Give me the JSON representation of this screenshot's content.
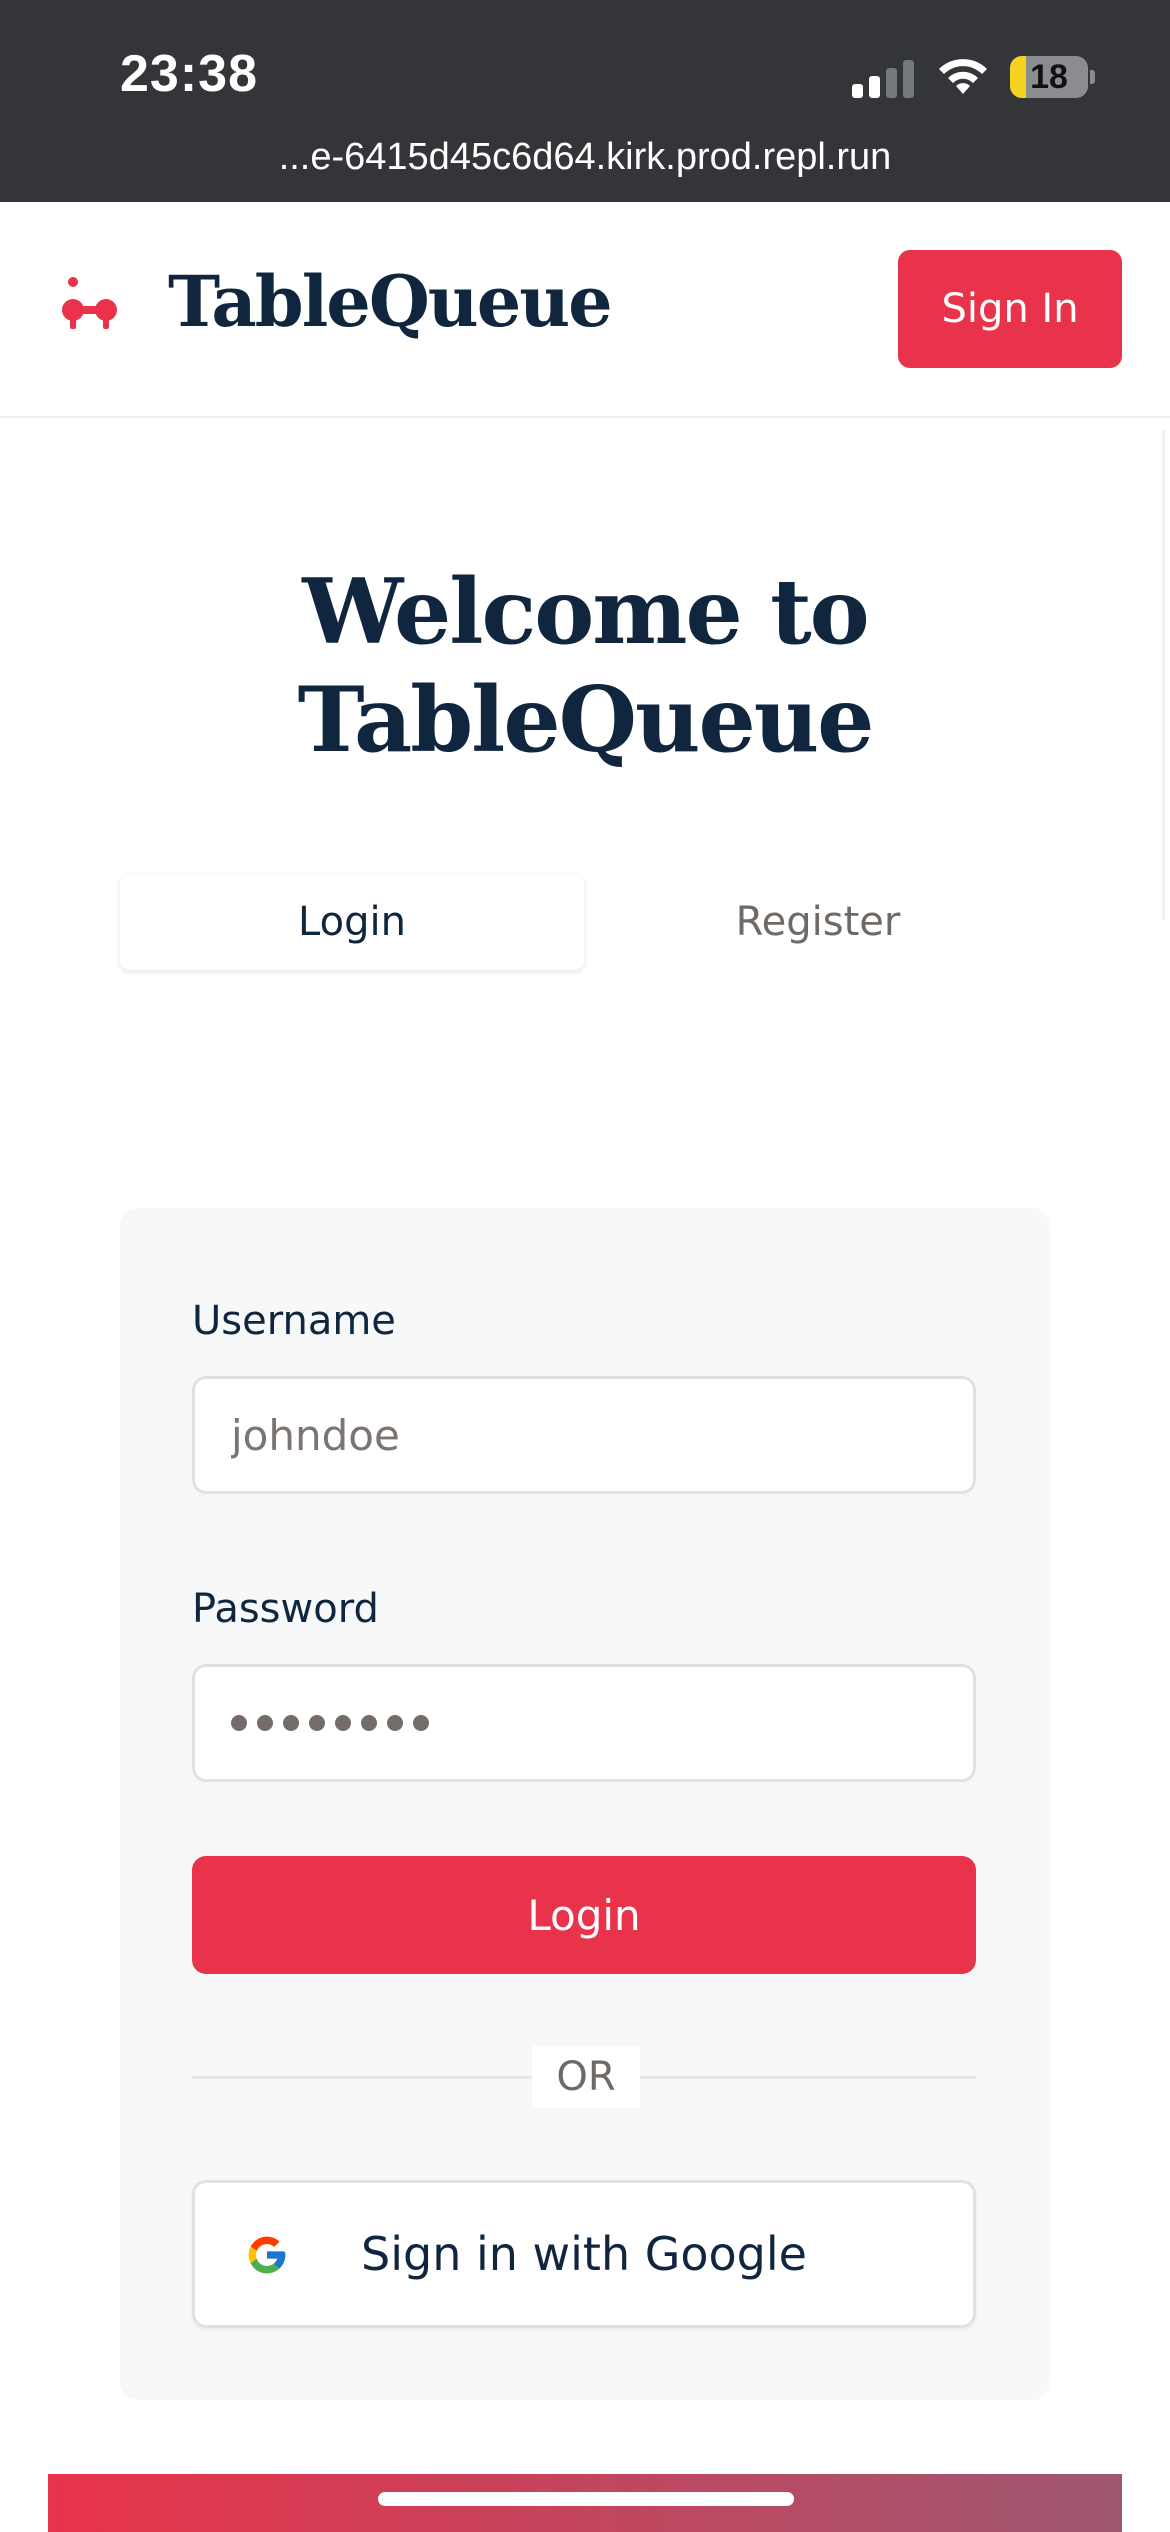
{
  "status_bar": {
    "time": "23:38",
    "battery_level": "18",
    "url": "...e-6415d45c6d64.kirk.prod.repl.run",
    "signal_icon": "cellular-signal-icon",
    "wifi_icon": "wifi-icon",
    "battery_icon": "battery-icon"
  },
  "header": {
    "brand": "TableQueue",
    "logo_icon": "tablequeue-logo-icon",
    "sign_in_label": "Sign In"
  },
  "welcome": {
    "line1": "Welcome to",
    "line2": "TableQueue"
  },
  "tabs": [
    {
      "label": "Login",
      "active": true
    },
    {
      "label": "Register",
      "active": false
    }
  ],
  "form": {
    "username_label": "Username",
    "username_placeholder": "johndoe",
    "password_label": "Password",
    "password_mask_length": 8,
    "login_label": "Login",
    "or_text": "OR",
    "google_label": "Sign in with Google",
    "google_icon": "google-g-icon"
  },
  "colors": {
    "accent": "#e8334a",
    "brand_navy": "#10263f",
    "status_bar": "#333538",
    "card_bg": "#f7f8fa"
  }
}
